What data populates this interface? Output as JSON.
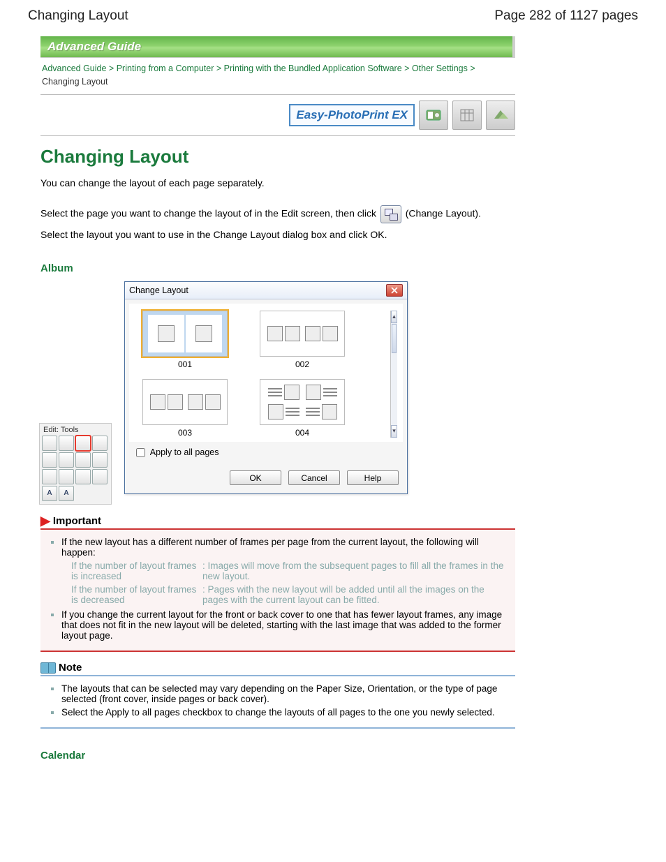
{
  "header": {
    "left": "Changing Layout",
    "right": "Page 282 of 1127 pages"
  },
  "banner": "Advanced Guide",
  "breadcrumb": {
    "items": [
      "Advanced Guide",
      "Printing from a Computer",
      "Printing with the Bundled Application Software",
      "Other Settings"
    ],
    "current": "Changing Layout",
    "sep": ">"
  },
  "app_logo": {
    "label": "Easy-PhotoPrint EX"
  },
  "page_title": "Changing Layout",
  "intro": {
    "p1": "You can change the layout of each page separately.",
    "p2a": "Select the page you want to change the layout of in the Edit screen, then click ",
    "p2b": " (Change Layout).",
    "p3": "Select the layout you want to use in the Change Layout dialog box and click OK."
  },
  "subheads": {
    "album": "Album",
    "calendar": "Calendar"
  },
  "edit_tools": {
    "title": "Edit: Tools"
  },
  "dialog": {
    "title": "Change Layout",
    "thumbs": [
      {
        "label": "001",
        "selected": true
      },
      {
        "label": "002",
        "selected": false
      },
      {
        "label": "003",
        "selected": false
      },
      {
        "label": "004",
        "selected": false
      }
    ],
    "apply_all": "Apply to all pages",
    "buttons": {
      "ok": "OK",
      "cancel": "Cancel",
      "help": "Help"
    }
  },
  "important": {
    "title": "Important",
    "bullet1": "If the new layout has a different number of frames per page from the current layout, the following will happen:",
    "rows": [
      {
        "c1": "If the number of layout frames is increased",
        "c2": ": Images will move from the subsequent pages to fill all the frames in the new layout."
      },
      {
        "c1": "If the number of layout frames is decreased",
        "c2": ": Pages with the new layout will be added until all the images on the pages with the current layout can be fitted."
      }
    ],
    "bullet2": "If you change the current layout for the front or back cover to one that has fewer layout frames, any image that does not fit in the new layout will be deleted, starting with the last image that was added to the former layout page."
  },
  "note": {
    "title": "Note",
    "bullet1": "The layouts that can be selected may vary depending on the Paper Size, Orientation, or the type of page selected (front cover, inside pages or back cover).",
    "bullet2": "Select the Apply to all pages checkbox to change the layouts of all pages to the one you newly selected."
  }
}
